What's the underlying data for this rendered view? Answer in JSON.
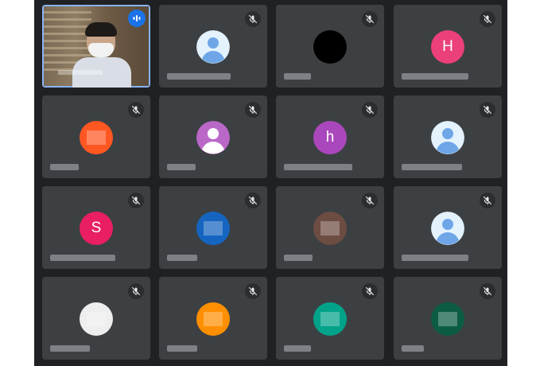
{
  "app": {
    "view": "meeting-grid"
  },
  "colors": {
    "stage_bg": "#202124",
    "tile_bg": "#3c4043",
    "speaking_ring": "#8ab4f8",
    "speaking_badge": "#1a73e8"
  },
  "participants": [
    {
      "id": "p01",
      "type": "video",
      "speaking": true,
      "muted": false
    },
    {
      "id": "p02",
      "type": "default",
      "muted": true,
      "avatar_color": "#e3f2fd"
    },
    {
      "id": "p03",
      "type": "photo",
      "muted": true,
      "avatar_color": "#000000"
    },
    {
      "id": "p04",
      "type": "letter",
      "letter": "H",
      "muted": true,
      "avatar_color": "#ec407a"
    },
    {
      "id": "p05",
      "type": "photo",
      "muted": true,
      "avatar_color": "#ff5722"
    },
    {
      "id": "p06",
      "type": "default",
      "muted": true,
      "avatar_color": "#ba68c8"
    },
    {
      "id": "p07",
      "type": "letter",
      "letter": "h",
      "muted": true,
      "avatar_color": "#ab47bc"
    },
    {
      "id": "p08",
      "type": "default",
      "muted": true,
      "avatar_color": "#e3f2fd"
    },
    {
      "id": "p09",
      "type": "letter",
      "letter": "S",
      "muted": true,
      "avatar_color": "#e91e63"
    },
    {
      "id": "p10",
      "type": "photo",
      "muted": true,
      "avatar_color": "#1565c0"
    },
    {
      "id": "p11",
      "type": "photo",
      "muted": true,
      "avatar_color": "#6d4c41"
    },
    {
      "id": "p12",
      "type": "default",
      "muted": true,
      "avatar_color": "#e3f2fd"
    },
    {
      "id": "p13",
      "type": "photo",
      "muted": true,
      "avatar_color": "#eeeeee"
    },
    {
      "id": "p14",
      "type": "photo",
      "muted": true,
      "avatar_color": "#ff8f00"
    },
    {
      "id": "p15",
      "type": "photo",
      "muted": true,
      "avatar_color": "#00a389"
    },
    {
      "id": "p16",
      "type": "photo",
      "muted": true,
      "avatar_color": "#0c5c45"
    }
  ],
  "icons": {
    "muted": "mic-off-icon",
    "speaking": "audio-levels-icon",
    "default_avatar": "person-icon"
  }
}
